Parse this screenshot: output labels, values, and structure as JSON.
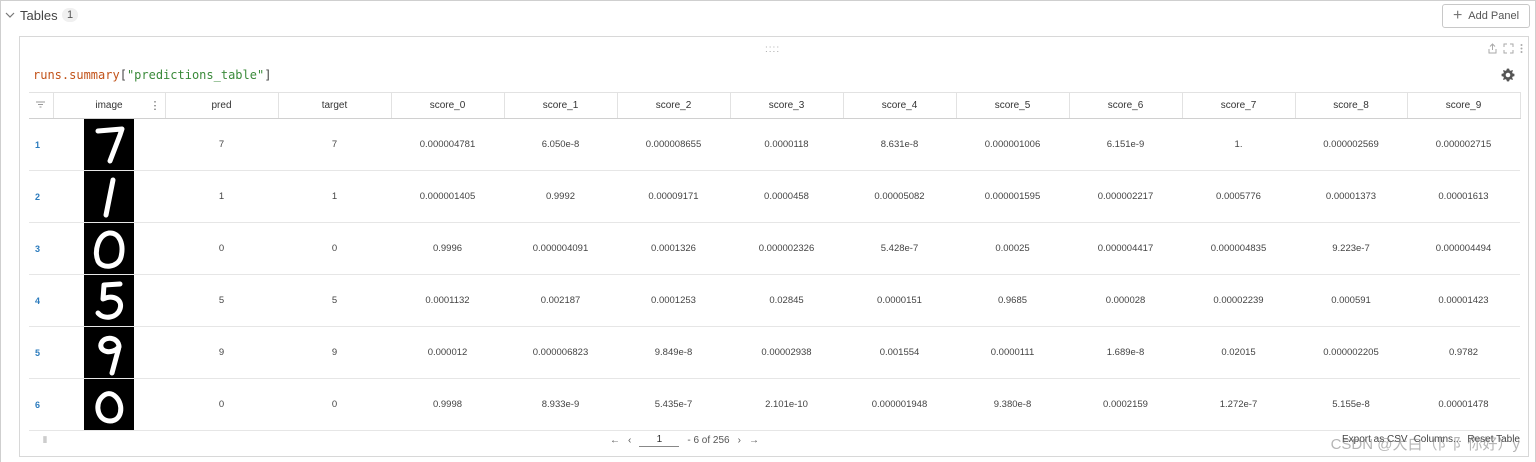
{
  "section": {
    "title": "Tables",
    "count": "1",
    "add_panel_label": "Add Panel"
  },
  "panel": {
    "drag_handle": "::::",
    "query": {
      "obj": "runs.summary",
      "open": "[",
      "key": "\"predictions_table\"",
      "close": "]"
    }
  },
  "table": {
    "columns": [
      "image",
      "pred",
      "target",
      "score_0",
      "score_1",
      "score_2",
      "score_3",
      "score_4",
      "score_5",
      "score_6",
      "score_7",
      "score_8",
      "score_9"
    ],
    "rows": [
      {
        "idx": "1",
        "digit": "7",
        "pred": "7",
        "target": "7",
        "scores": [
          "0.000004781",
          "6.050e-8",
          "0.000008655",
          "0.0000118",
          "8.631e-8",
          "0.000001006",
          "6.151e-9",
          "1.",
          "0.000002569",
          "0.000002715"
        ]
      },
      {
        "idx": "2",
        "digit": "1",
        "pred": "1",
        "target": "1",
        "scores": [
          "0.000001405",
          "0.9992",
          "0.00009171",
          "0.0000458",
          "0.00005082",
          "0.000001595",
          "0.000002217",
          "0.0005776",
          "0.00001373",
          "0.00001613"
        ]
      },
      {
        "idx": "3",
        "digit": "0",
        "pred": "0",
        "target": "0",
        "scores": [
          "0.9996",
          "0.000004091",
          "0.0001326",
          "0.000002326",
          "5.428e-7",
          "0.00025",
          "0.000004417",
          "0.000004835",
          "9.223e-7",
          "0.000004494"
        ]
      },
      {
        "idx": "4",
        "digit": "5",
        "pred": "5",
        "target": "5",
        "scores": [
          "0.0001132",
          "0.002187",
          "0.0001253",
          "0.02845",
          "0.0000151",
          "0.9685",
          "0.000028",
          "0.00002239",
          "0.000591",
          "0.00001423"
        ]
      },
      {
        "idx": "5",
        "digit": "9",
        "pred": "9",
        "target": "9",
        "scores": [
          "0.000012",
          "0.000006823",
          "9.849e-8",
          "0.00002938",
          "0.001554",
          "0.0000111",
          "1.689e-8",
          "0.02015",
          "0.000002205",
          "0.9782"
        ]
      },
      {
        "idx": "6",
        "digit": "0",
        "pred": "0",
        "target": "0",
        "scores": [
          "0.9998",
          "8.933e-9",
          "5.435e-7",
          "2.101e-10",
          "0.000001948",
          "9.380e-8",
          "0.0002159",
          "1.272e-7",
          "5.155e-8",
          "0.00001478"
        ]
      }
    ]
  },
  "pagination": {
    "prev_first": "←",
    "prev": "‹",
    "page": "1",
    "range": "- 6 of 256",
    "next": "›",
    "next_last": "→"
  },
  "footer_actions": {
    "export": "Export as CSV",
    "columns": "Columns...",
    "reset": "Reset Table"
  },
  "watermark": "CSDN @大白（阝阝你好）y",
  "colors": {
    "accent_link": "#2b7bbd",
    "code_object": "#c2531a",
    "code_string": "#3a8a3a"
  },
  "icons": [
    "chevron-down-icon",
    "plus-icon",
    "drag-handle-icon",
    "share-icon",
    "fullscreen-icon",
    "more-icon",
    "gear-icon",
    "filter-icon",
    "column-menu-icon"
  ]
}
